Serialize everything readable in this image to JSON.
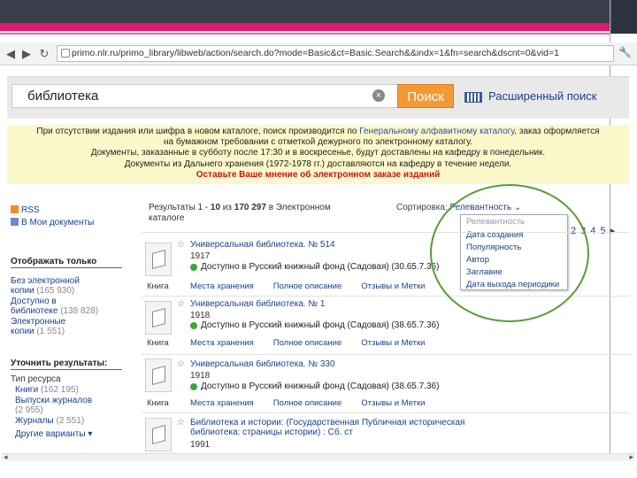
{
  "browser": {
    "url": "primo.nlr.ru/primo_library/libweb/action/search.do?mode=Basic&ct=Basic.Search&&indx=1&fn=search&dscnt=0&vid=1",
    "back_icon": "back-arrow-icon",
    "forward_icon": "forward-arrow-icon",
    "reload_icon": "reload-icon",
    "wrench_icon": "wrench-icon"
  },
  "search": {
    "query": "библиотека",
    "button": "Поиск",
    "advanced": "Расширенный поиск"
  },
  "notice": {
    "line1_a": "При отсутствии издания или шифра в новом каталоге, поиск производится по ",
    "line1_link": "Генеральному алфавитному каталогу",
    "line1_b": ", заказ оформляется",
    "line2": "на бумажном требовании с отметкой дежурного по электронному каталогу.",
    "line3": "Документы, заказанные в субботу после 17:30 и в воскресенье, будут доставлены на кафедру в понедельник.",
    "line4": "Документы из Дальнего хранения (1972-1978 гг.) доставляются на кафедру в течение недели.",
    "line5": "Оставьте Ваше мнение об электронном заказе изданий"
  },
  "sidebar": {
    "rss": "RSS",
    "my_docs": "В Мои документы",
    "show_only_title": "Отображать только",
    "show_only": [
      {
        "label": "Без электронной",
        "label2": "копии",
        "count": "(165 930)"
      },
      {
        "label": "Доступно в",
        "label2": "библиотеке",
        "count": "(138 828)"
      },
      {
        "label": "Электронные",
        "label2": "копии",
        "count": "(1 551)"
      }
    ],
    "refine_title": "Уточнить результаты:",
    "resource_type": "Тип ресурса",
    "refine": [
      {
        "label": "Книги",
        "count": "(162 195)"
      },
      {
        "label": "Выпуски журналов",
        "count": "(2 955)"
      },
      {
        "label": "Журналы",
        "count": "(2 551)"
      }
    ],
    "more": "Другие варианты"
  },
  "results": {
    "head_a": "Результаты 1 - ",
    "head_range": "10",
    "head_b": " из ",
    "head_total": "170 297",
    "head_c": " в Электронном",
    "head_d": "каталоге",
    "sort_label": "Сортировка: ",
    "sort_current": "Релевантность",
    "sort_options": [
      "Релевантность",
      "Дата создания",
      "Популярность",
      "Автор",
      "Заглавие",
      "Дата выхода периодики"
    ],
    "pager": "2 3 4 5",
    "items": [
      {
        "title": "Универсальная библиотека. № 514",
        "title2": "",
        "year": "1917",
        "availability": "Доступно в Русский книжный фонд (Садовая) (30.65.7.36)",
        "type": "Книга"
      },
      {
        "title": "Универсальная библиотека. № 1",
        "title2": "",
        "year": "1918",
        "availability": "Доступно в Русский книжный фонд (Садовая) (38.65.7.36)",
        "type": "Книга"
      },
      {
        "title": "Универсальная библиотека. № 330",
        "title2": "",
        "year": "1918",
        "availability": "Доступно в Русский книжный фонд (Садовая) (38.65.7.36)",
        "type": "Книга"
      },
      {
        "title": "Библиотека и истории: (Государственная Публичная историческая",
        "title2": "библиотека: страницы истории) : Сб. ст",
        "year": "1991",
        "availability": "",
        "type": ""
      }
    ],
    "tabs": [
      "Места хранения",
      "Полное описание",
      "Отзывы и Метки"
    ]
  }
}
